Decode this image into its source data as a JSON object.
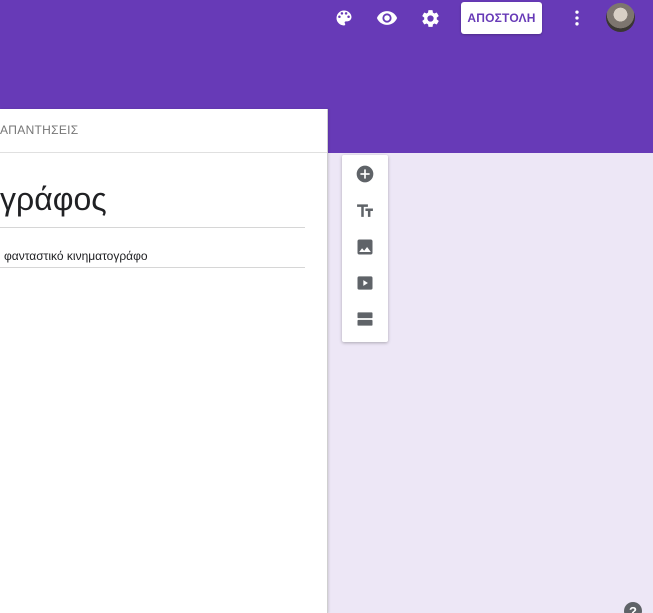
{
  "header": {
    "send_label": "ΑΠΟΣΤΟΛΗ",
    "icons": [
      "palette-icon",
      "eye-icon",
      "gear-icon",
      "more-vert-icon"
    ],
    "accent_color": "#673ab7"
  },
  "form": {
    "tab_responses": "ΑΠΑΝΤΗΣΕΙΣ",
    "title": "γράφος",
    "description": "φανταστικό κινηματογράφο"
  },
  "toolbar": {
    "tools": [
      "add-question-icon",
      "add-title-icon",
      "add-image-icon",
      "add-video-icon",
      "add-section-icon"
    ]
  },
  "help": {
    "label": "?"
  },
  "colors": {
    "header_bg": "#673ab7",
    "page_bg": "#ede7f6",
    "icon_gray": "#5f6368"
  }
}
